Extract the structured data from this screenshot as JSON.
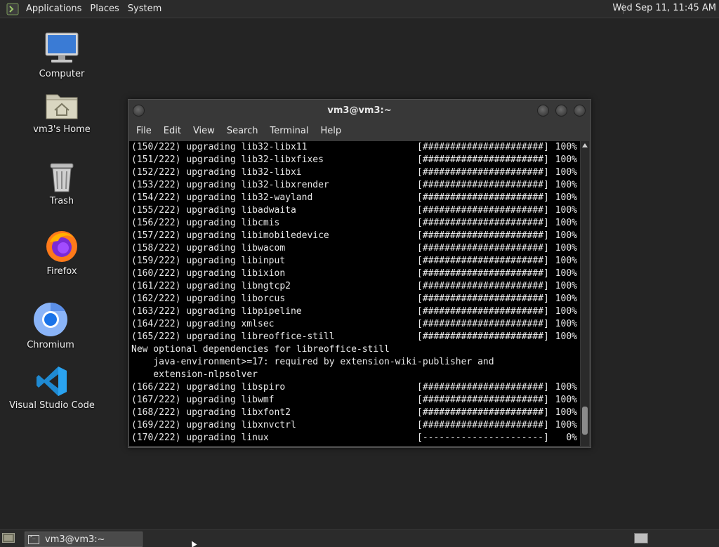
{
  "top_panel": {
    "menus": [
      "Applications",
      "Places",
      "System"
    ],
    "clock": "Wed Sep 11, 11:45 AM"
  },
  "desktop_icons": {
    "computer": "Computer",
    "home": "vm3's Home",
    "trash": "Trash",
    "firefox": "Firefox",
    "chromium": "Chromium",
    "vscode": "Visual Studio Code"
  },
  "terminal": {
    "title": "vm3@vm3:~",
    "menu": [
      "File",
      "Edit",
      "View",
      "Search",
      "Terminal",
      "Help"
    ],
    "lines": [
      {
        "text": "(150/222) upgrading lib32-libx11",
        "bar": "[######################]",
        "pct": "100%"
      },
      {
        "text": "(151/222) upgrading lib32-libxfixes",
        "bar": "[######################]",
        "pct": "100%"
      },
      {
        "text": "(152/222) upgrading lib32-libxi",
        "bar": "[######################]",
        "pct": "100%"
      },
      {
        "text": "(153/222) upgrading lib32-libxrender",
        "bar": "[######################]",
        "pct": "100%"
      },
      {
        "text": "(154/222) upgrading lib32-wayland",
        "bar": "[######################]",
        "pct": "100%"
      },
      {
        "text": "(155/222) upgrading libadwaita",
        "bar": "[######################]",
        "pct": "100%"
      },
      {
        "text": "(156/222) upgrading libcmis",
        "bar": "[######################]",
        "pct": "100%"
      },
      {
        "text": "(157/222) upgrading libimobiledevice",
        "bar": "[######################]",
        "pct": "100%"
      },
      {
        "text": "(158/222) upgrading libwacom",
        "bar": "[######################]",
        "pct": "100%"
      },
      {
        "text": "(159/222) upgrading libinput",
        "bar": "[######################]",
        "pct": "100%"
      },
      {
        "text": "(160/222) upgrading libixion",
        "bar": "[######################]",
        "pct": "100%"
      },
      {
        "text": "(161/222) upgrading libngtcp2",
        "bar": "[######################]",
        "pct": "100%"
      },
      {
        "text": "(162/222) upgrading liborcus",
        "bar": "[######################]",
        "pct": "100%"
      },
      {
        "text": "(163/222) upgrading libpipeline",
        "bar": "[######################]",
        "pct": "100%"
      },
      {
        "text": "(164/222) upgrading xmlsec",
        "bar": "[######################]",
        "pct": "100%"
      },
      {
        "text": "(165/222) upgrading libreoffice-still",
        "bar": "[######################]",
        "pct": "100%"
      },
      {
        "text": "New optional dependencies for libreoffice-still",
        "bar": "",
        "pct": ""
      },
      {
        "text": "    java-environment>=17: required by extension-wiki-publisher and",
        "bar": "",
        "pct": ""
      },
      {
        "text": "    extension-nlpsolver",
        "bar": "",
        "pct": ""
      },
      {
        "text": "(166/222) upgrading libspiro",
        "bar": "[######################]",
        "pct": "100%"
      },
      {
        "text": "(167/222) upgrading libwmf",
        "bar": "[######################]",
        "pct": "100%"
      },
      {
        "text": "(168/222) upgrading libxfont2",
        "bar": "[######################]",
        "pct": "100%"
      },
      {
        "text": "(169/222) upgrading libxnvctrl",
        "bar": "[######################]",
        "pct": "100%"
      },
      {
        "text": "(170/222) upgrading linux",
        "bar": "[----------------------]",
        "pct": "0%"
      }
    ]
  },
  "taskbar": {
    "task_label": "vm3@vm3:~"
  },
  "colors": {
    "desktop": "#242424",
    "panel": "#2b2b2b",
    "terminal_bg": "#000000",
    "terminal_fg": "#e8e8e8"
  }
}
